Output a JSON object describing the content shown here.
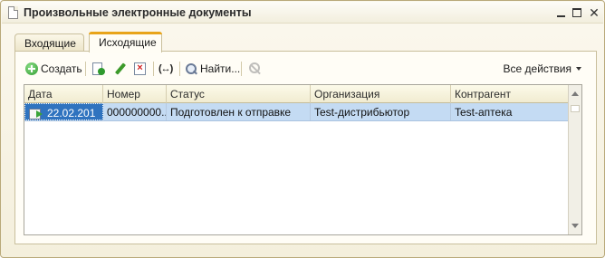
{
  "window": {
    "title": "Произвольные электронные документы",
    "controls": {
      "minimize": "—",
      "maximize": "☐",
      "close": "✕"
    }
  },
  "tabs": [
    {
      "label": "Входящие",
      "active": false
    },
    {
      "label": "Исходящие",
      "active": true
    }
  ],
  "toolbar": {
    "create_label": "Создать",
    "find_label": "Найти...",
    "arrows_label": "(↔)",
    "all_actions_label": "Все действия",
    "delete_mark": "×",
    "icons": [
      "create-icon",
      "copy-icon",
      "edit-icon",
      "delete-icon",
      "change-range-icon",
      "search-icon",
      "cancel-search-icon"
    ]
  },
  "table": {
    "columns": [
      "Дата",
      "Номер",
      "Статус",
      "Организация",
      "Контрагент"
    ],
    "rows": [
      {
        "date": "22.02.201",
        "number": "000000000...",
        "status": "Подготовлен к отправке",
        "organization": "Test-дистрибьютор",
        "counterparty": "Test-аптека"
      }
    ]
  },
  "colors": {
    "window_bg": "#f4efdc",
    "active_tab_accent": "#e8a41a",
    "selected_row": "#c4dbf3",
    "focused_cell": "#2f73bf"
  }
}
